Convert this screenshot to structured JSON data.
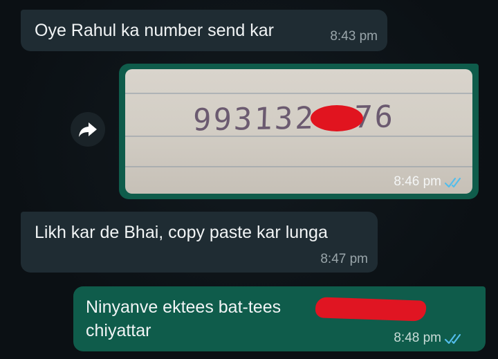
{
  "messages": [
    {
      "direction": "incoming",
      "text": "Oye Rahul ka number send kar",
      "time": "8:43 pm"
    },
    {
      "direction": "outgoing",
      "type": "image",
      "handwriting_start": "993132",
      "handwriting_end": "76",
      "time": "8:46 pm",
      "status": "read"
    },
    {
      "direction": "incoming",
      "text": "Likh kar de Bhai, copy paste kar lunga",
      "time": "8:47 pm"
    },
    {
      "direction": "outgoing",
      "text_line1": "Ninyanve ektees bat-tees",
      "text_line2": "chiyattar",
      "time": "8:48 pm",
      "status": "read"
    }
  ],
  "colors": {
    "background": "#0b1014",
    "incoming_bubble": "#1f2c33",
    "outgoing_bubble": "#0f5c4b",
    "read_ticks": "#53bdeb",
    "redaction": "#e1141f"
  },
  "icons": {
    "forward": "forward-arrow-icon",
    "read_receipt": "double-check-icon"
  }
}
